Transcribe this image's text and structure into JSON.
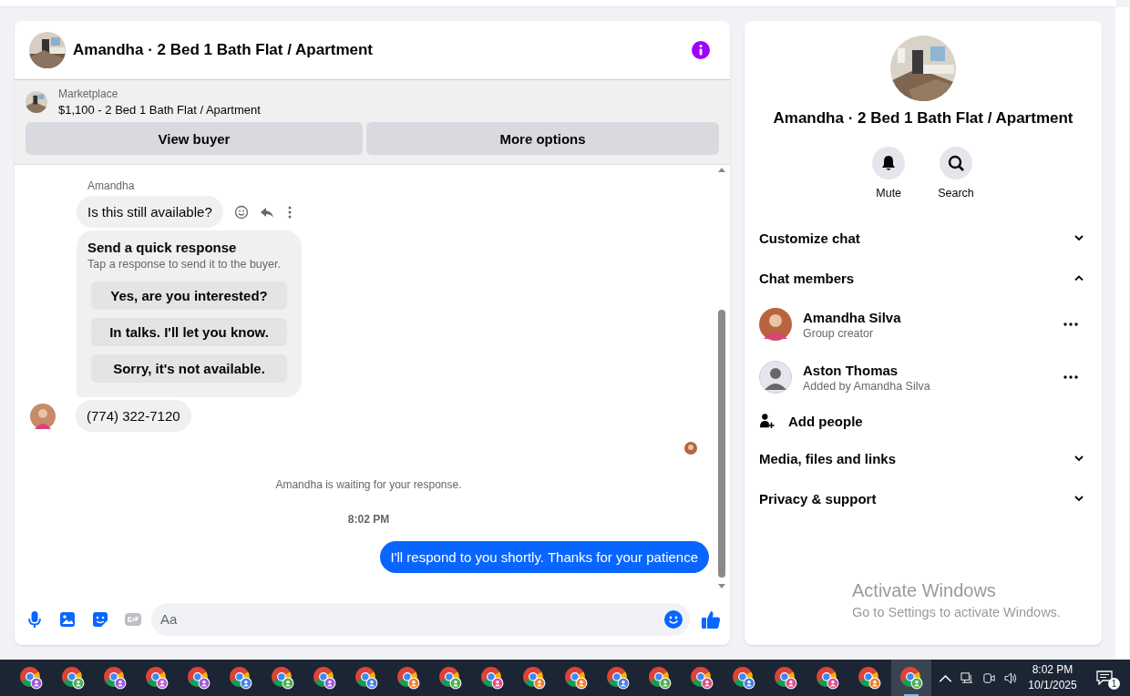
{
  "conversation": {
    "title": "Amandha · 2 Bed 1 Bath Flat / Apartment",
    "listing": {
      "source": "Marketplace",
      "title": "$1,100 - 2 Bed 1 Bath Flat / Apartment",
      "buttons": [
        "View buyer",
        "More options"
      ]
    },
    "messages": [
      {
        "kind": "incoming",
        "sender": "Amandha",
        "text": "Is this still available?"
      },
      {
        "kind": "quick_responses",
        "title": "Send a quick response",
        "subtitle": "Tap a response to send it to the buyer.",
        "options": [
          "Yes, are you interested?",
          "In talks. I'll let you know.",
          "Sorry, it's not available."
        ]
      },
      {
        "kind": "incoming",
        "avatar": true,
        "text": "(774) 322-7120"
      },
      {
        "kind": "seen"
      },
      {
        "kind": "notice",
        "text": "Amandha is waiting for your response."
      },
      {
        "kind": "time",
        "text": "8:02 PM"
      },
      {
        "kind": "outgoing",
        "text": "I'll respond to you shortly. Thanks for your patience"
      }
    ],
    "composer": {
      "placeholder": "Aa"
    }
  },
  "details": {
    "title": "Amandha · 2 Bed 1 Bath Flat / Apartment",
    "actions": [
      {
        "kind": "mute",
        "label": "Mute"
      },
      {
        "kind": "search",
        "label": "Search"
      }
    ],
    "sections": [
      {
        "label": "Customize chat",
        "expanded": false
      },
      {
        "label": "Chat members",
        "expanded": true,
        "members": [
          {
            "name": "Amandha Silva",
            "role": "Group creator"
          },
          {
            "name": "Aston Thomas",
            "role": "Added by Amandha Silva",
            "kind": "default"
          }
        ],
        "add_label": "Add people"
      },
      {
        "label": "Media, files and links",
        "expanded": false
      },
      {
        "label": "Privacy & support",
        "expanded": false
      }
    ]
  },
  "os_notice": {
    "title": "Activate Windows",
    "text": "Go to Settings to activate Windows."
  },
  "taskbar": {
    "apps": [
      {
        "color": "#a05ad8",
        "selected": false
      },
      {
        "color": "#4caf50",
        "selected": false
      },
      {
        "color": "#a05ad8",
        "selected": false
      },
      {
        "color": "#c060d0",
        "selected": false
      },
      {
        "color": "#a05ad8",
        "selected": false
      },
      {
        "color": "#4a7fe0",
        "selected": false
      },
      {
        "color": "#4caf50",
        "selected": false
      },
      {
        "color": "#a05ad8",
        "selected": false
      },
      {
        "color": "#4a7fe0",
        "selected": false
      },
      {
        "color": "#f08030",
        "selected": false
      },
      {
        "color": "#4caf50",
        "selected": false
      },
      {
        "color": "#e0508a",
        "selected": false
      },
      {
        "color": "#f08030",
        "selected": false
      },
      {
        "color": "#f08030",
        "selected": false
      },
      {
        "color": "#4a7fe0",
        "selected": false
      },
      {
        "color": "#4caf50",
        "selected": false
      },
      {
        "color": "#e0508a",
        "selected": false
      },
      {
        "color": "#4a7fe0",
        "selected": false
      },
      {
        "color": "#e0508a",
        "selected": false
      },
      {
        "color": "#e0508a",
        "selected": false
      },
      {
        "color": "#f08030",
        "selected": false
      },
      {
        "color": "#4caf50",
        "selected": true
      }
    ],
    "time": "8:02 PM",
    "date": "10/1/2025",
    "notification_count": "1"
  }
}
